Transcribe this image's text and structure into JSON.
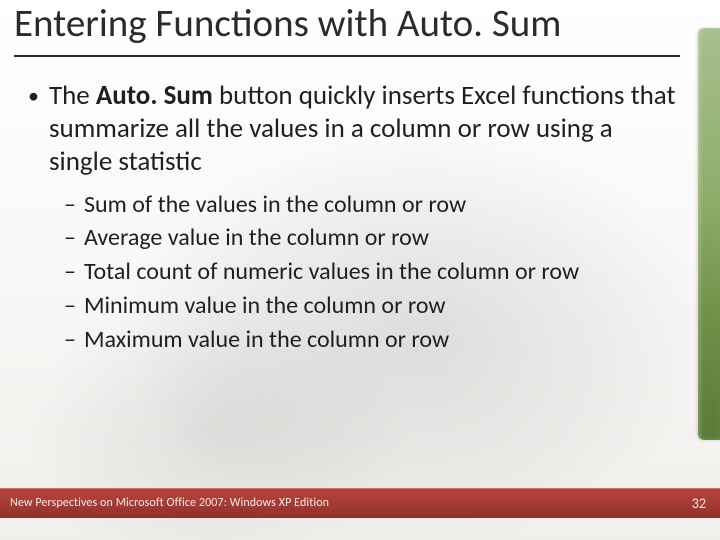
{
  "title": "Entering Functions with Auto. Sum",
  "main_bullet": {
    "prefix": "The ",
    "bold": "Auto. Sum",
    "rest": " button quickly inserts Excel functions that summarize all the values in a column or row using a single statistic"
  },
  "sub_bullets": [
    "Sum of the values in the column or row",
    "Average value in the column or row",
    "Total count of numeric values in the column or row",
    "Minimum value in the column or row",
    "Maximum value in the column or row"
  ],
  "footer": "New Perspectives on Microsoft Office 2007: Windows XP Edition",
  "page_number": "32"
}
